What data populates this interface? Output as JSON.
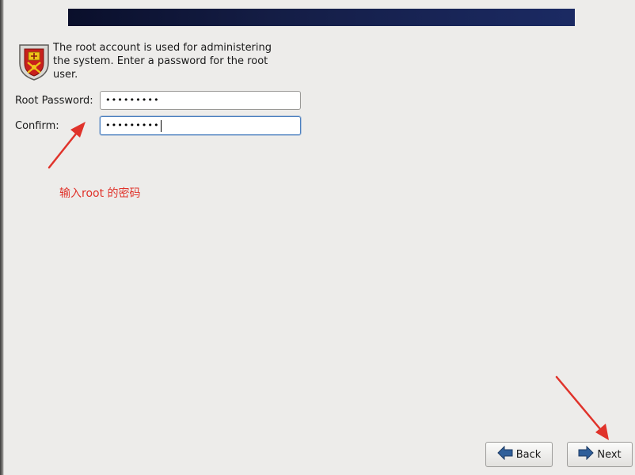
{
  "header": {
    "banner_color": "#141d45"
  },
  "description": {
    "text": "The root account is used for administering the system.  Enter a password for the root user."
  },
  "form": {
    "root_password_label": "Root Password:",
    "root_password_value": "•••••••••",
    "confirm_label": "Confirm:",
    "confirm_value": "•••••••••"
  },
  "annotation": {
    "text": "输入root 的密码",
    "color": "#e0332b"
  },
  "buttons": {
    "back_label": "Back",
    "next_label": "Next"
  },
  "icons": {
    "security": "shield-crest-icon",
    "back": "arrow-left-icon",
    "next": "arrow-right-icon"
  }
}
